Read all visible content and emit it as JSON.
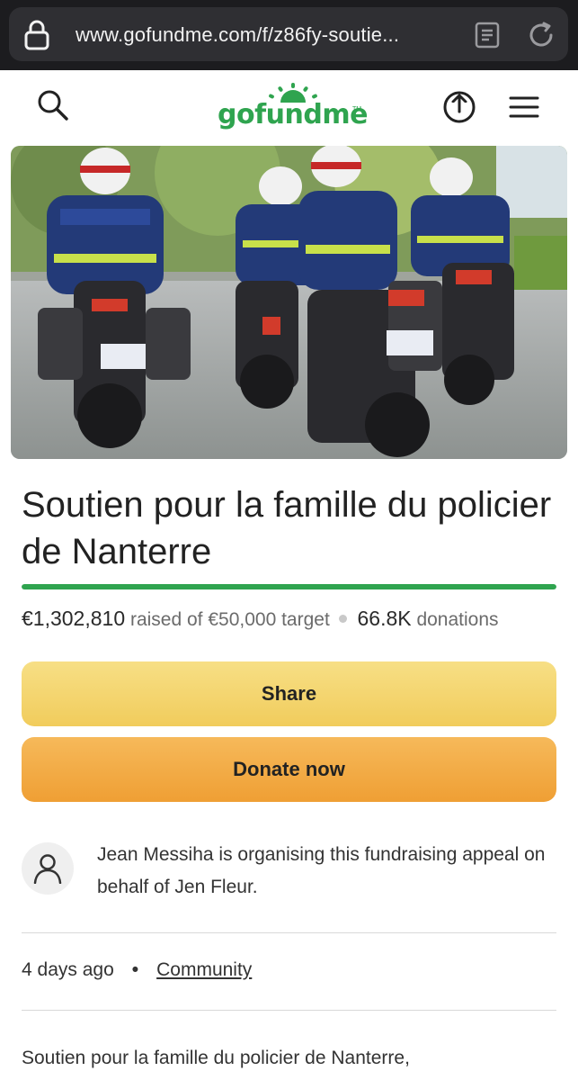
{
  "browser": {
    "url": "www.gofundme.com/f/z86fy-soutie..."
  },
  "header": {
    "logo_text": "gofundme",
    "logo_tm": "TM",
    "icons": [
      "search-icon",
      "share-upload-icon",
      "hamburger-menu-icon"
    ]
  },
  "campaign": {
    "title": "Soutien pour la famille du policier de Nanterre",
    "raised": "€1,302,810",
    "raised_suffix": "raised of €50,000 target",
    "donations_count": "66.8K",
    "donations_label": "donations",
    "progress_fraction": 1.0
  },
  "buttons": {
    "share": "Share",
    "donate": "Donate now"
  },
  "organiser": {
    "text": "Jean Messiha is organising this fundraising appeal on behalf of Jen Fleur."
  },
  "meta": {
    "age": "4 days ago",
    "category": "Community"
  },
  "description": {
    "first_line": "Soutien pour la famille du policier de Nanterre,"
  },
  "colors": {
    "brand_green": "#2fa44f",
    "share_button": "#f3d26a",
    "donate_button": "#f2aa42",
    "browser_bar": "#1c1c1f"
  }
}
